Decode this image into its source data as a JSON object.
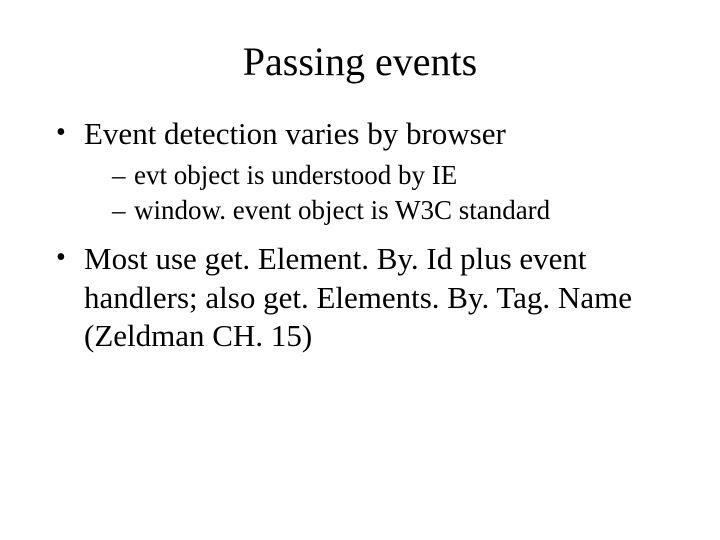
{
  "slide": {
    "title": "Passing events",
    "bullets": [
      {
        "text": "Event detection varies by browser",
        "sub": [
          "evt object is understood by IE",
          "window. event object is W3C standard"
        ]
      },
      {
        "text": "Most use get. Element. By. Id plus event handlers; also get. Elements. By. Tag. Name (Zeldman CH. 15)",
        "sub": []
      }
    ]
  }
}
